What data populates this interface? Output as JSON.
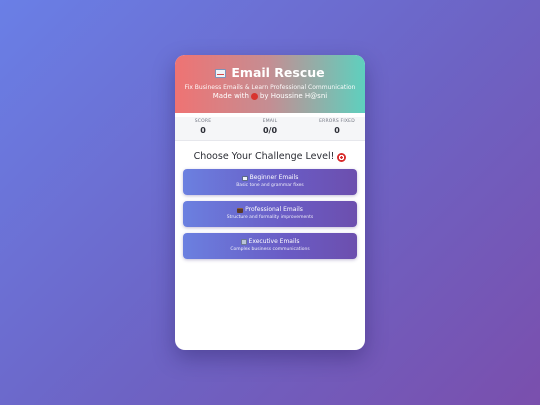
{
  "header": {
    "title": "Email Rescue",
    "subtitle": "Fix Business Emails & Learn Professional Communication",
    "made_with_prefix": "Made with",
    "made_with_suffix": "by Houssine H@sni",
    "colors": {
      "gradient_start": "#ef7373",
      "gradient_end": "#5ed0be"
    }
  },
  "stats": [
    {
      "label": "SCORE",
      "value": "0"
    },
    {
      "label": "EMAIL",
      "value": "0/0"
    },
    {
      "label": "ERRORS FIXED",
      "value": "0"
    }
  ],
  "level_title": "Choose Your Challenge Level!",
  "levels": [
    {
      "label": "Beginner Emails",
      "description": "Basic tone and grammar fixes",
      "icon": "email-icon"
    },
    {
      "label": "Professional Emails",
      "description": "Structure and formality improvements",
      "icon": "briefcase-icon"
    },
    {
      "label": "Executive Emails",
      "description": "Complex business communications",
      "icon": "building-icon"
    }
  ],
  "colors": {
    "background_start": "#6a7fe6",
    "background_end": "#7a4fad",
    "button_start": "#6b80e0",
    "button_end": "#6c4fae"
  }
}
